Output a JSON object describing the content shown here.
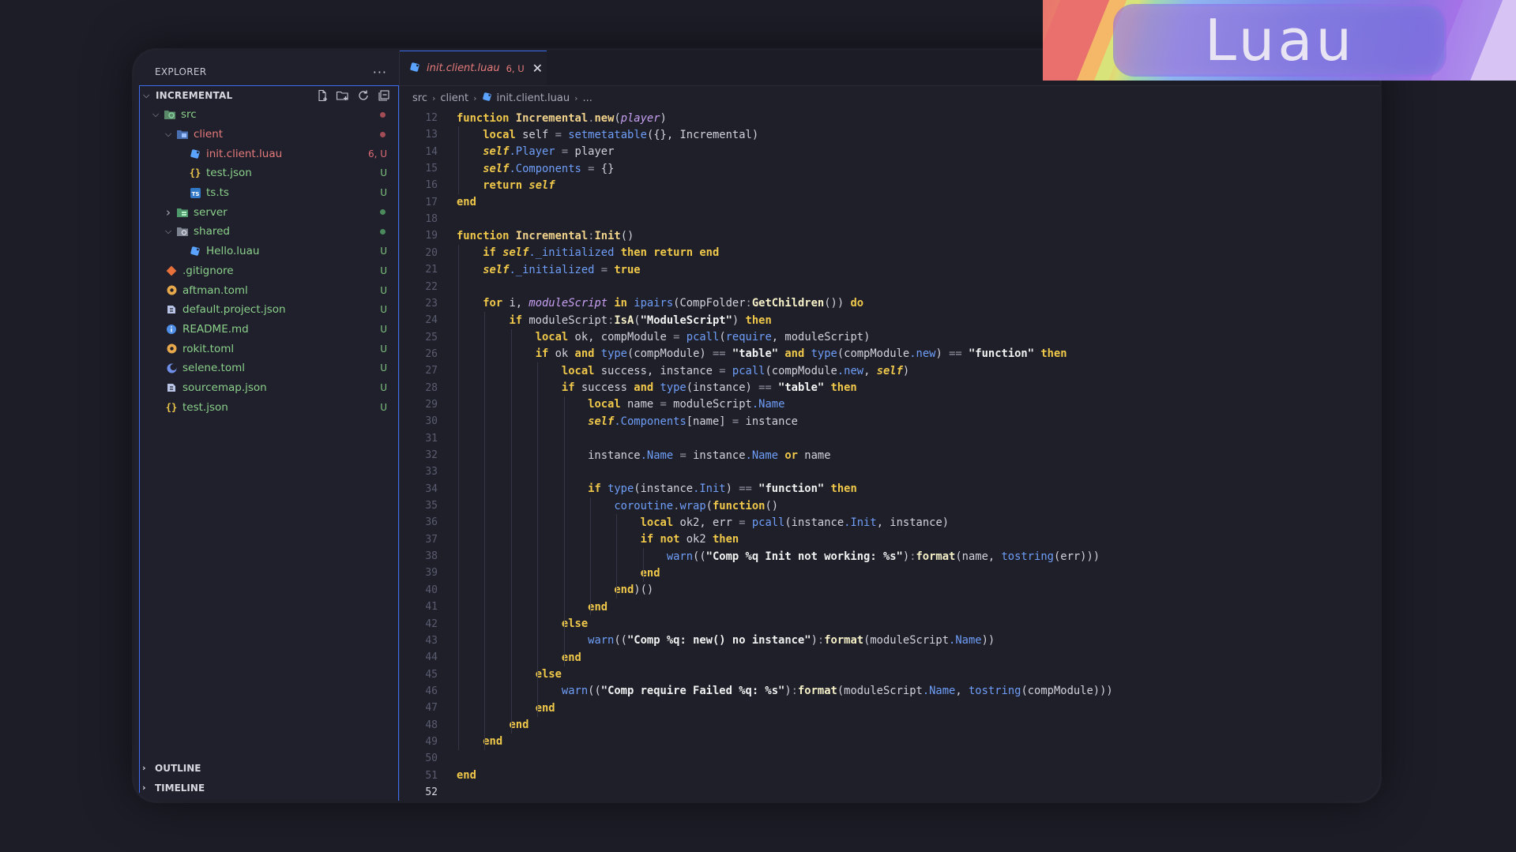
{
  "sidebar": {
    "title": "EXPLORER",
    "more": "···",
    "project": "INCREMENTAL",
    "tree": [
      {
        "name": "src",
        "depth": 0,
        "type": "folder-src",
        "open": true,
        "status": "dot-red"
      },
      {
        "name": "client",
        "depth": 1,
        "type": "folder-client",
        "open": true,
        "status": "dot-red",
        "label_color": "#e77b7b"
      },
      {
        "name": "init.client.luau",
        "depth": 2,
        "type": "luau",
        "status": "6, U",
        "label_color": "#e77b7b"
      },
      {
        "name": "test.json",
        "depth": 2,
        "type": "json",
        "status": "U"
      },
      {
        "name": "ts.ts",
        "depth": 2,
        "type": "ts",
        "status": "U"
      },
      {
        "name": "server",
        "depth": 1,
        "type": "folder-server",
        "open": false,
        "status": "dot-green"
      },
      {
        "name": "shared",
        "depth": 1,
        "type": "folder-shared",
        "open": true,
        "status": "dot-green"
      },
      {
        "name": "Hello.luau",
        "depth": 2,
        "type": "luau",
        "status": "U"
      },
      {
        "name": ".gitignore",
        "depth": 0,
        "type": "git",
        "status": "U"
      },
      {
        "name": "aftman.toml",
        "depth": 0,
        "type": "toml",
        "status": "U"
      },
      {
        "name": "default.project.json",
        "depth": 0,
        "type": "rojo",
        "status": "U"
      },
      {
        "name": "README.md",
        "depth": 0,
        "type": "info",
        "status": "U"
      },
      {
        "name": "rokit.toml",
        "depth": 0,
        "type": "toml",
        "status": "U"
      },
      {
        "name": "selene.toml",
        "depth": 0,
        "type": "selene",
        "status": "U"
      },
      {
        "name": "sourcemap.json",
        "depth": 0,
        "type": "rojo",
        "status": "U"
      },
      {
        "name": "test.json",
        "depth": 0,
        "type": "json",
        "status": "U"
      }
    ],
    "outline": "OUTLINE",
    "timeline": "TIMELINE"
  },
  "tab": {
    "name": "init.client.luau",
    "badge": "6, U",
    "close": "✕"
  },
  "breadcrumb": {
    "src": "src",
    "client": "client",
    "file": "init.client.luau",
    "more": "..."
  },
  "code": {
    "active_line": 52,
    "lines": [
      {
        "n": "12",
        "segs": [
          [
            "kw",
            "function "
          ],
          [
            "fn",
            "Incremental"
          ],
          [
            "op",
            "."
          ],
          [
            "fn",
            "new"
          ],
          [
            "",
            "("
          ],
          [
            "par",
            "player"
          ],
          [
            "",
            ")"
          ]
        ]
      },
      {
        "n": "13",
        "segs": [
          [
            "",
            "    "
          ],
          [
            "kw",
            "local "
          ],
          [
            "",
            "self "
          ],
          [
            "op",
            "= "
          ],
          [
            "bi",
            "setmetatable"
          ],
          [
            "",
            "({}, Incremental)"
          ]
        ]
      },
      {
        "n": "14",
        "segs": [
          [
            "",
            "    "
          ],
          [
            "self",
            "self"
          ],
          [
            "prop",
            ".Player"
          ],
          [
            "op",
            " = "
          ],
          [
            "",
            "player"
          ]
        ]
      },
      {
        "n": "15",
        "segs": [
          [
            "",
            "    "
          ],
          [
            "self",
            "self"
          ],
          [
            "prop",
            ".Components"
          ],
          [
            "op",
            " = "
          ],
          [
            "",
            "{}"
          ]
        ]
      },
      {
        "n": "16",
        "segs": [
          [
            "",
            "    "
          ],
          [
            "kw",
            "return "
          ],
          [
            "self",
            "self"
          ]
        ]
      },
      {
        "n": "17",
        "segs": [
          [
            "kw",
            "end"
          ]
        ]
      },
      {
        "n": "18",
        "segs": []
      },
      {
        "n": "19",
        "segs": [
          [
            "kw",
            "function "
          ],
          [
            "fn",
            "Incremental"
          ],
          [
            "op",
            ":"
          ],
          [
            "fn",
            "Init"
          ],
          [
            "",
            "()"
          ]
        ]
      },
      {
        "n": "20",
        "segs": [
          [
            "",
            "    "
          ],
          [
            "kw",
            "if "
          ],
          [
            "self",
            "self"
          ],
          [
            "prop",
            "._initialized "
          ],
          [
            "kw",
            "then return end"
          ]
        ]
      },
      {
        "n": "21",
        "segs": [
          [
            "",
            "    "
          ],
          [
            "self",
            "self"
          ],
          [
            "prop",
            "._initialized"
          ],
          [
            "op",
            " = "
          ],
          [
            "kw",
            "true"
          ]
        ]
      },
      {
        "n": "22",
        "segs": []
      },
      {
        "n": "23",
        "segs": [
          [
            "",
            "    "
          ],
          [
            "kw",
            "for "
          ],
          [
            "",
            "i, "
          ],
          [
            "par",
            "moduleScript "
          ],
          [
            "kw",
            "in "
          ],
          [
            "bi",
            "ipairs"
          ],
          [
            "",
            "(CompFolder"
          ],
          [
            "op",
            ":"
          ],
          [
            "meth",
            "GetChildren"
          ],
          [
            "",
            "()) "
          ],
          [
            "kw",
            "do"
          ]
        ]
      },
      {
        "n": "24",
        "segs": [
          [
            "",
            "        "
          ],
          [
            "kw",
            "if "
          ],
          [
            "",
            "moduleScript"
          ],
          [
            "op",
            ":"
          ],
          [
            "meth",
            "IsA"
          ],
          [
            "",
            "("
          ],
          [
            "str",
            "\"ModuleScript\""
          ],
          [
            "",
            ") "
          ],
          [
            "kw",
            "then"
          ]
        ]
      },
      {
        "n": "25",
        "segs": [
          [
            "",
            "            "
          ],
          [
            "kw",
            "local "
          ],
          [
            "",
            "ok, compModule "
          ],
          [
            "op",
            "= "
          ],
          [
            "bi",
            "pcall"
          ],
          [
            "",
            "("
          ],
          [
            "bi",
            "require"
          ],
          [
            "",
            ", moduleScript)"
          ]
        ]
      },
      {
        "n": "26",
        "segs": [
          [
            "",
            "            "
          ],
          [
            "kw",
            "if "
          ],
          [
            "",
            "ok "
          ],
          [
            "kw",
            "and "
          ],
          [
            "bi",
            "type"
          ],
          [
            "",
            "(compModule) "
          ],
          [
            "op",
            "== "
          ],
          [
            "str",
            "\"table\" "
          ],
          [
            "kw",
            "and "
          ],
          [
            "bi",
            "type"
          ],
          [
            "",
            "(compModule"
          ],
          [
            "prop",
            ".new"
          ],
          [
            "",
            ") "
          ],
          [
            "op",
            "== "
          ],
          [
            "str",
            "\"function\" "
          ],
          [
            "kw",
            "then"
          ]
        ]
      },
      {
        "n": "27",
        "segs": [
          [
            "",
            "                "
          ],
          [
            "kw",
            "local "
          ],
          [
            "",
            "success, instance "
          ],
          [
            "op",
            "= "
          ],
          [
            "bi",
            "pcall"
          ],
          [
            "",
            "(compModule"
          ],
          [
            "prop",
            ".new"
          ],
          [
            "",
            ", "
          ],
          [
            "self",
            "self"
          ],
          [
            "",
            ")"
          ]
        ]
      },
      {
        "n": "28",
        "segs": [
          [
            "",
            "                "
          ],
          [
            "kw",
            "if "
          ],
          [
            "",
            "success "
          ],
          [
            "kw",
            "and "
          ],
          [
            "bi",
            "type"
          ],
          [
            "",
            "(instance) "
          ],
          [
            "op",
            "== "
          ],
          [
            "str",
            "\"table\" "
          ],
          [
            "kw",
            "then"
          ]
        ]
      },
      {
        "n": "29",
        "segs": [
          [
            "",
            "                    "
          ],
          [
            "kw",
            "local "
          ],
          [
            "",
            "name "
          ],
          [
            "op",
            "= "
          ],
          [
            "",
            "moduleScript"
          ],
          [
            "prop",
            ".Name"
          ]
        ]
      },
      {
        "n": "30",
        "segs": [
          [
            "",
            "                    "
          ],
          [
            "self",
            "self"
          ],
          [
            "prop",
            ".Components"
          ],
          [
            "",
            "[name] "
          ],
          [
            "op",
            "= "
          ],
          [
            "",
            "instance"
          ]
        ]
      },
      {
        "n": "31",
        "segs": []
      },
      {
        "n": "32",
        "segs": [
          [
            "",
            "                    instance"
          ],
          [
            "prop",
            ".Name"
          ],
          [
            "op",
            " = "
          ],
          [
            "",
            "instance"
          ],
          [
            "prop",
            ".Name "
          ],
          [
            "kw",
            "or "
          ],
          [
            "",
            "name"
          ]
        ]
      },
      {
        "n": "33",
        "segs": []
      },
      {
        "n": "34",
        "segs": [
          [
            "",
            "                    "
          ],
          [
            "kw",
            "if "
          ],
          [
            "bi",
            "type"
          ],
          [
            "",
            "(instance"
          ],
          [
            "prop",
            ".Init"
          ],
          [
            "",
            ") "
          ],
          [
            "op",
            "== "
          ],
          [
            "str",
            "\"function\" "
          ],
          [
            "kw",
            "then"
          ]
        ]
      },
      {
        "n": "35",
        "segs": [
          [
            "",
            "                        "
          ],
          [
            "bi",
            "coroutine"
          ],
          [
            "op",
            "."
          ],
          [
            "bi",
            "wrap"
          ],
          [
            "",
            "("
          ],
          [
            "kw",
            "function"
          ],
          [
            "",
            "()"
          ]
        ]
      },
      {
        "n": "36",
        "segs": [
          [
            "",
            "                            "
          ],
          [
            "kw",
            "local "
          ],
          [
            "",
            "ok2, err "
          ],
          [
            "op",
            "= "
          ],
          [
            "bi",
            "pcall"
          ],
          [
            "",
            "(instance"
          ],
          [
            "prop",
            ".Init"
          ],
          [
            "",
            ", instance)"
          ]
        ]
      },
      {
        "n": "37",
        "segs": [
          [
            "",
            "                            "
          ],
          [
            "kw",
            "if not "
          ],
          [
            "",
            "ok2 "
          ],
          [
            "kw",
            "then"
          ]
        ]
      },
      {
        "n": "38",
        "segs": [
          [
            "",
            "                                "
          ],
          [
            "bi",
            "warn"
          ],
          [
            "",
            "(("
          ],
          [
            "str",
            "\"Comp %q Init not working: %s\""
          ],
          [
            "",
            ")"
          ],
          [
            "op",
            ":"
          ],
          [
            "meth",
            "format"
          ],
          [
            "",
            "(name, "
          ],
          [
            "bi",
            "tostring"
          ],
          [
            "",
            "(err)))"
          ]
        ]
      },
      {
        "n": "39",
        "segs": [
          [
            "",
            "                            "
          ],
          [
            "kw",
            "end"
          ]
        ]
      },
      {
        "n": "40",
        "segs": [
          [
            "",
            "                        "
          ],
          [
            "kw",
            "end"
          ],
          [
            "",
            ")()"
          ]
        ]
      },
      {
        "n": "41",
        "segs": [
          [
            "",
            "                    "
          ],
          [
            "kw",
            "end"
          ]
        ]
      },
      {
        "n": "42",
        "segs": [
          [
            "",
            "                "
          ],
          [
            "kw",
            "else"
          ]
        ]
      },
      {
        "n": "43",
        "segs": [
          [
            "",
            "                    "
          ],
          [
            "bi",
            "warn"
          ],
          [
            "",
            "(("
          ],
          [
            "str",
            "\"Comp %q: new() no instance\""
          ],
          [
            "",
            ")"
          ],
          [
            "op",
            ":"
          ],
          [
            "meth",
            "format"
          ],
          [
            "",
            "(moduleScript"
          ],
          [
            "prop",
            ".Name"
          ],
          [
            "",
            "))"
          ]
        ]
      },
      {
        "n": "44",
        "segs": [
          [
            "",
            "                "
          ],
          [
            "kw",
            "end"
          ]
        ]
      },
      {
        "n": "45",
        "segs": [
          [
            "",
            "            "
          ],
          [
            "kw",
            "else"
          ]
        ]
      },
      {
        "n": "46",
        "segs": [
          [
            "",
            "                "
          ],
          [
            "bi",
            "warn"
          ],
          [
            "",
            "(("
          ],
          [
            "str",
            "\"Comp require Failed %q: %s\""
          ],
          [
            "",
            ")"
          ],
          [
            "op",
            ":"
          ],
          [
            "meth",
            "format"
          ],
          [
            "",
            "(moduleScript"
          ],
          [
            "prop",
            ".Name"
          ],
          [
            "",
            ", "
          ],
          [
            "bi",
            "tostring"
          ],
          [
            "",
            "(compModule)))"
          ]
        ]
      },
      {
        "n": "47",
        "segs": [
          [
            "",
            "            "
          ],
          [
            "kw",
            "end"
          ]
        ]
      },
      {
        "n": "48",
        "segs": [
          [
            "",
            "        "
          ],
          [
            "kw",
            "end"
          ]
        ]
      },
      {
        "n": "49",
        "segs": [
          [
            "",
            "    "
          ],
          [
            "kw",
            "end"
          ]
        ]
      },
      {
        "n": "50",
        "segs": []
      },
      {
        "n": "51",
        "segs": [
          [
            "kw",
            "end"
          ]
        ]
      },
      {
        "n": "52",
        "segs": []
      }
    ]
  },
  "logo": {
    "text": "Luau"
  },
  "colors": {
    "accent": "#3d6df0",
    "untracked": "#8bd08b",
    "modified": "#e77b7b",
    "keyword": "#f0c84a",
    "builtin": "#6f9ef8"
  }
}
